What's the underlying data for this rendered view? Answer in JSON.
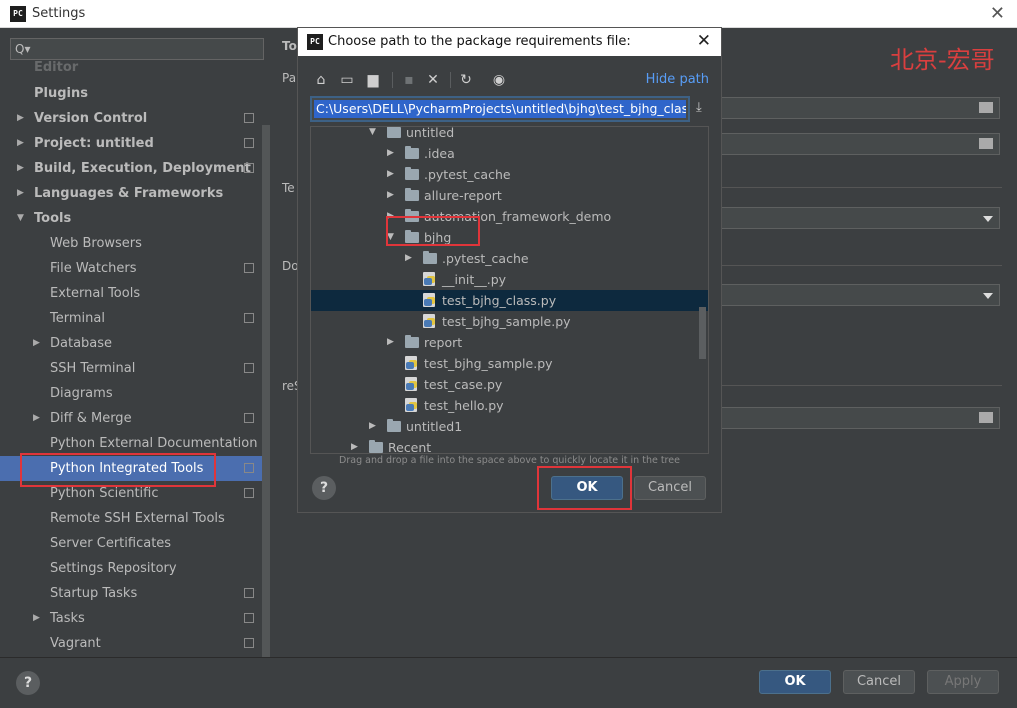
{
  "window": {
    "title": "Settings",
    "app_icon": "PC"
  },
  "watermark": "北京-宏哥",
  "sidebar": {
    "search_placeholder": "Q▾",
    "items": [
      {
        "label": "Editor",
        "bold": true
      },
      {
        "label": "Plugins",
        "bold": true
      },
      {
        "label": "Version Control",
        "bold": true,
        "expandable": true
      },
      {
        "label": "Project: untitled",
        "bold": true,
        "expandable": true
      },
      {
        "label": "Build, Execution, Deployment",
        "bold": true,
        "expandable": true
      },
      {
        "label": "Languages & Frameworks",
        "bold": true,
        "expandable": true
      },
      {
        "label": "Tools",
        "bold": true,
        "expanded": true
      },
      {
        "label": "Web Browsers"
      },
      {
        "label": "File Watchers"
      },
      {
        "label": "External Tools"
      },
      {
        "label": "Terminal"
      },
      {
        "label": "Database",
        "expandable": true
      },
      {
        "label": "SSH Terminal"
      },
      {
        "label": "Diagrams"
      },
      {
        "label": "Diff & Merge",
        "expandable": true
      },
      {
        "label": "Python External Documentation"
      },
      {
        "label": "Python Integrated Tools",
        "selected": true
      },
      {
        "label": "Python Scientific"
      },
      {
        "label": "Remote SSH External Tools"
      },
      {
        "label": "Server Certificates"
      },
      {
        "label": "Settings Repository"
      },
      {
        "label": "Startup Tasks"
      },
      {
        "label": "Tasks",
        "expandable": true
      },
      {
        "label": "Vagrant"
      }
    ]
  },
  "content": {
    "cut_labels": [
      "To",
      "Pa",
      "Te",
      "Do",
      "reS"
    ]
  },
  "footer": {
    "help": "?",
    "ok": "OK",
    "cancel": "Cancel",
    "apply": "Apply"
  },
  "dialog": {
    "title": "Choose path to the package requirements file:",
    "app_icon": "PC",
    "hide_path": "Hide path",
    "path_value": "C:\\Users\\DELL\\PycharmProjects\\untitled\\bjhg\\test_bjhg_class.py",
    "tree": [
      {
        "label": "untitled",
        "type": "folder",
        "depth": 4,
        "expanded": true
      },
      {
        "label": ".idea",
        "type": "folder",
        "depth": 5,
        "collapsed": true
      },
      {
        "label": ".pytest_cache",
        "type": "folder",
        "depth": 5,
        "collapsed": true
      },
      {
        "label": "allure-report",
        "type": "folder",
        "depth": 5,
        "collapsed": true
      },
      {
        "label": "automation_framework_demo",
        "type": "folder",
        "depth": 5,
        "collapsed": true
      },
      {
        "label": "bjhg",
        "type": "folder",
        "depth": 5,
        "expanded": true
      },
      {
        "label": ".pytest_cache",
        "type": "folder",
        "depth": 6,
        "collapsed": true
      },
      {
        "label": "__init__.py",
        "type": "py",
        "depth": 6
      },
      {
        "label": "test_bjhg_class.py",
        "type": "py",
        "depth": 6,
        "selected": true
      },
      {
        "label": "test_bjhg_sample.py",
        "type": "py",
        "depth": 6
      },
      {
        "label": "report",
        "type": "folder",
        "depth": 5,
        "collapsed": true
      },
      {
        "label": "test_bjhg_sample.py",
        "type": "py",
        "depth": 5
      },
      {
        "label": "test_case.py",
        "type": "py",
        "depth": 5
      },
      {
        "label": "test_hello.py",
        "type": "py",
        "depth": 5
      },
      {
        "label": "untitled1",
        "type": "folder",
        "depth": 4,
        "collapsed": true
      },
      {
        "label": "Recent",
        "type": "folder",
        "depth": 3,
        "collapsed": true
      }
    ],
    "hint": "Drag and drop a file into the space above to quickly locate it in the tree",
    "help": "?",
    "ok": "OK",
    "cancel": "Cancel"
  },
  "colors": {
    "accent": "#365880",
    "selection": "#4b6eaf",
    "highlight_box": "#e0353a",
    "link": "#589df6"
  }
}
